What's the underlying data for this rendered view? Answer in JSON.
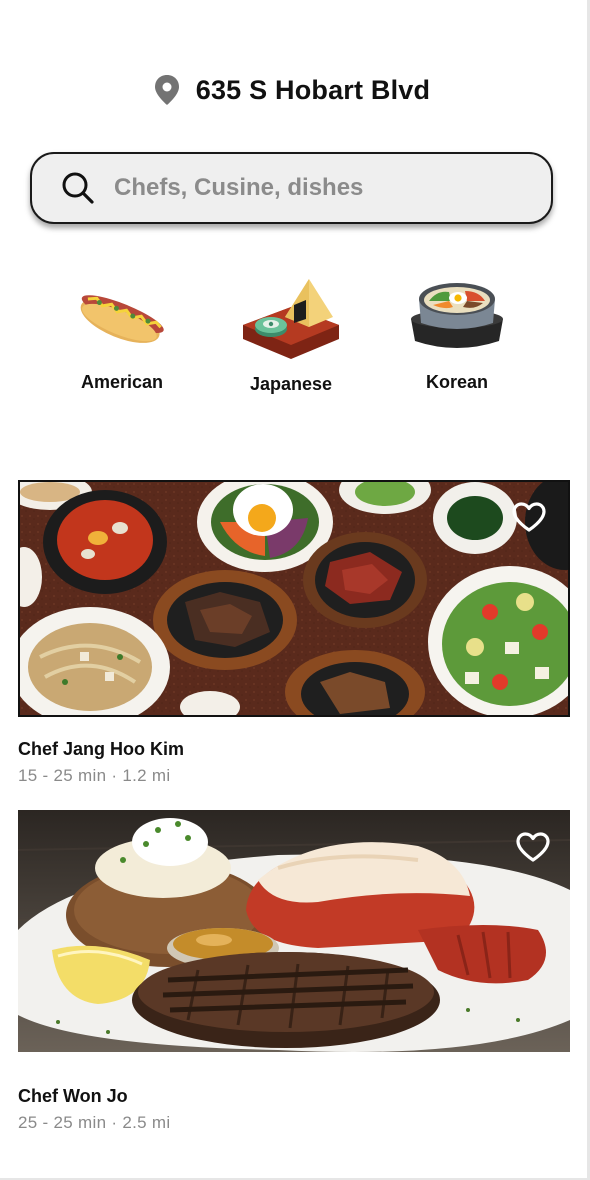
{
  "header": {
    "location_icon": "map-pin-icon",
    "address": "635 S Hobart Blvd"
  },
  "search": {
    "icon": "search-icon",
    "placeholder": "Chefs, Cusine, dishes",
    "value": ""
  },
  "categories": [
    {
      "label": "American",
      "icon": "hot-dog-icon"
    },
    {
      "label": "Japanese",
      "icon": "onigiri-bento-icon"
    },
    {
      "label": "Korean",
      "icon": "bibimbap-pot-icon"
    }
  ],
  "chefs": [
    {
      "name": "Chef Jang Hoo Kim",
      "meta": "15 - 25 min · 1.2 mi",
      "photo": "korean-feast-photo",
      "favorite_icon": "heart-outline-icon",
      "favorited": false
    },
    {
      "name": "Chef Won Jo",
      "meta": "25 - 25 min · 2.5 mi",
      "photo": "steak-lobster-photo",
      "favorite_icon": "heart-outline-icon",
      "favorited": false
    }
  ],
  "colors": {
    "text": "#111111",
    "muted": "#8a8a8a",
    "search_bg": "#efefef",
    "pin": "#737373"
  }
}
